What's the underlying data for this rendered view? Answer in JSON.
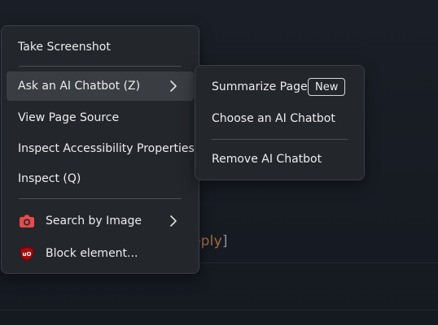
{
  "background": {
    "link_text": "eply",
    "bracket_text": "]"
  },
  "context_menu": {
    "items": [
      {
        "label": "Take Screenshot"
      },
      {
        "label": "Ask an AI Chatbot (Z)"
      },
      {
        "label": "View Page Source"
      },
      {
        "label": "Inspect Accessibility Properties"
      },
      {
        "label": "Inspect (Q)"
      },
      {
        "label": "Search by Image",
        "icon": "camera-icon"
      },
      {
        "label": "Block element...",
        "icon": "ublock-shield-icon"
      }
    ]
  },
  "chatbot_submenu": {
    "items": [
      {
        "label": "Summarize Page",
        "badge": "New"
      },
      {
        "label": "Choose an AI Chatbot"
      },
      {
        "label": "Remove AI Chatbot"
      }
    ]
  },
  "colors": {
    "menu_background": "#23262b",
    "hover_background": "#3a3d42",
    "camera_icon": "#e64b4b",
    "shield_icon": "#800000",
    "page_background": "#171b22"
  }
}
